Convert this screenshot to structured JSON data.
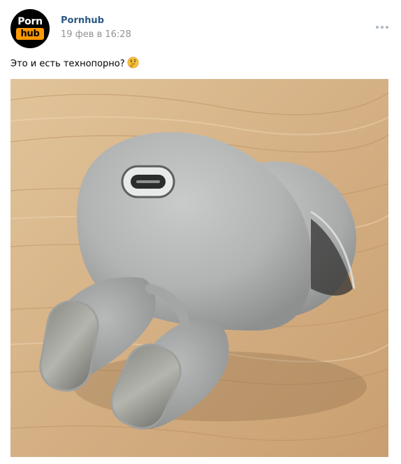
{
  "post": {
    "author": "Pornhub",
    "date": "19 фев в 16:28",
    "text": "Это и есть технопорно?",
    "emoji": "thinking-face",
    "avatar": {
      "top_text": "Porn",
      "bottom_text": "hub",
      "accent_color": "#ff9900"
    }
  },
  "colors": {
    "author_link": "#2a5885",
    "date_gray": "#939393",
    "more_dots": "#aeb7c2"
  }
}
